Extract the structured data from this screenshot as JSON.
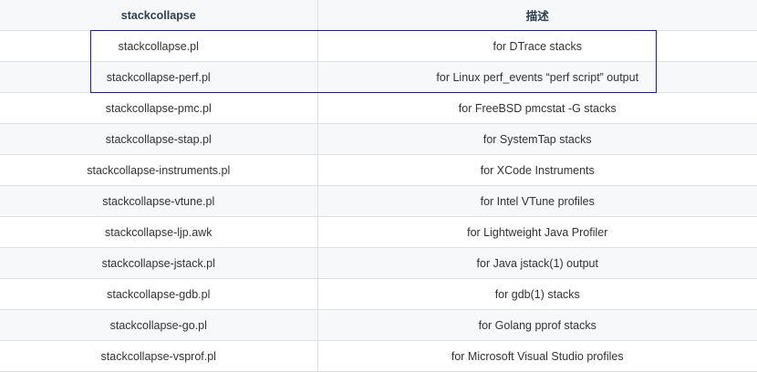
{
  "table": {
    "headers": [
      "stackcollapse",
      "描述"
    ],
    "rows": [
      [
        "stackcollapse.pl",
        "for DTrace stacks"
      ],
      [
        "stackcollapse-perf.pl",
        "for Linux perf_events “perf script” output"
      ],
      [
        "stackcollapse-pmc.pl",
        "for FreeBSD pmcstat -G stacks"
      ],
      [
        "stackcollapse-stap.pl",
        "for SystemTap stacks"
      ],
      [
        "stackcollapse-instruments.pl",
        "for XCode Instruments"
      ],
      [
        "stackcollapse-vtune.pl",
        "for Intel VTune profiles"
      ],
      [
        "stackcollapse-ljp.awk",
        "for Lightweight Java Profiler"
      ],
      [
        "stackcollapse-jstack.pl",
        "for Java jstack(1) output"
      ],
      [
        "stackcollapse-gdb.pl",
        "for gdb(1) stacks"
      ],
      [
        "stackcollapse-go.pl",
        "for Golang pprof stacks"
      ],
      [
        "stackcollapse-vsprof.pl",
        "for Microsoft Visual Studio profiles"
      ]
    ]
  },
  "colors": {
    "highlight_border": "#1a1aa6",
    "header_text": "#2c3e50",
    "stripe": "#f6f8fa",
    "grid": "#dfe2e5"
  }
}
